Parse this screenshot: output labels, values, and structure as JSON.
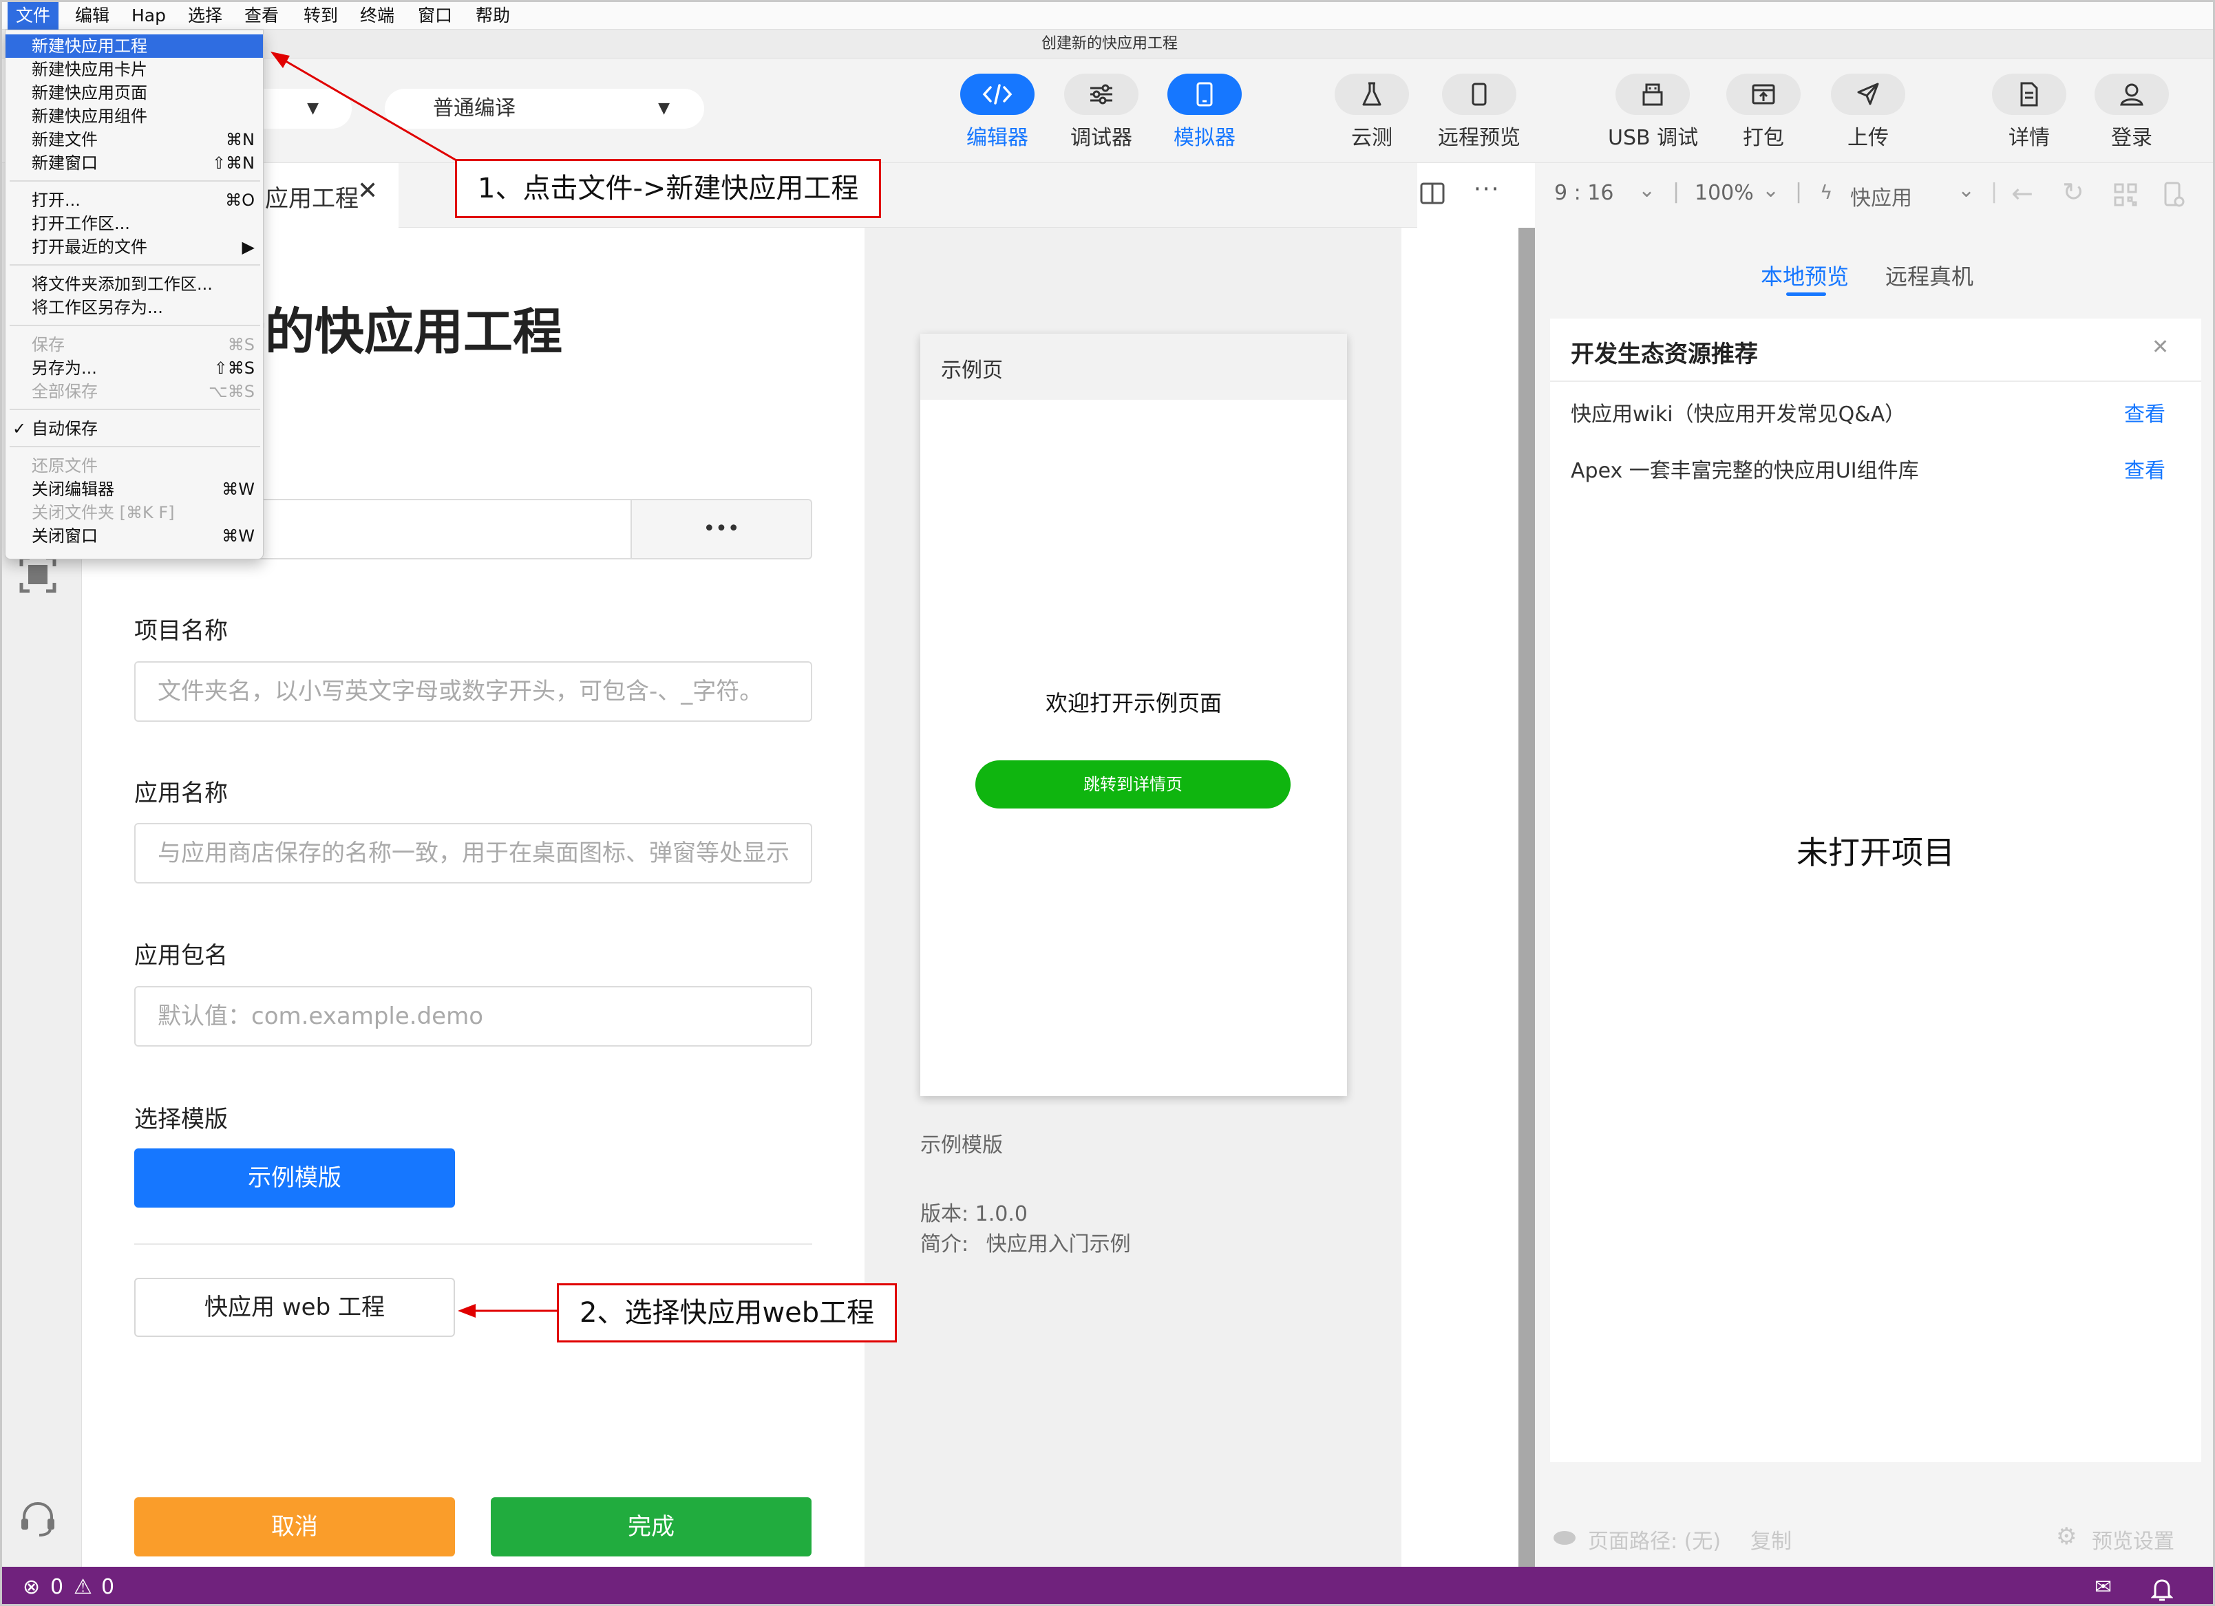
{
  "menubar": {
    "items": [
      "文件",
      "编辑",
      "Hap",
      "选择",
      "查看",
      "转到",
      "终端",
      "窗口",
      "帮助"
    ]
  },
  "titlebar": {
    "title": "创建新的快应用工程"
  },
  "toolbar": {
    "dropdown1": "",
    "dropdown2": "普通编译",
    "buttons": [
      "编辑器",
      "调试器",
      "模拟器",
      "云测",
      "远程预览",
      "USB 调试",
      "打包",
      "上传",
      "详情",
      "登录"
    ]
  },
  "file_menu": {
    "items": [
      {
        "label": "新建快应用工程",
        "shortcut": "",
        "state": "highlighted"
      },
      {
        "label": "新建快应用卡片",
        "shortcut": "",
        "state": "normal"
      },
      {
        "label": "新建快应用页面",
        "shortcut": "",
        "state": "normal"
      },
      {
        "label": "新建快应用组件",
        "shortcut": "",
        "state": "normal"
      },
      {
        "label": "新建文件",
        "shortcut": "⌘N",
        "state": "normal"
      },
      {
        "label": "新建窗口",
        "shortcut": "⇧⌘N",
        "state": "normal"
      },
      {
        "label": "打开...",
        "shortcut": "⌘O",
        "state": "normal"
      },
      {
        "label": "打开工作区...",
        "shortcut": "",
        "state": "normal"
      },
      {
        "label": "打开最近的文件",
        "shortcut": "▶",
        "state": "normal"
      },
      {
        "label": "将文件夹添加到工作区...",
        "shortcut": "",
        "state": "normal"
      },
      {
        "label": "将工作区另存为...",
        "shortcut": "",
        "state": "normal"
      },
      {
        "label": "保存",
        "shortcut": "⌘S",
        "state": "disabled"
      },
      {
        "label": "另存为...",
        "shortcut": "⇧⌘S",
        "state": "normal"
      },
      {
        "label": "全部保存",
        "shortcut": "⌥⌘S",
        "state": "disabled"
      },
      {
        "label": "自动保存",
        "shortcut": "",
        "state": "checked"
      },
      {
        "label": "还原文件",
        "shortcut": "",
        "state": "disabled"
      },
      {
        "label": "关闭编辑器",
        "shortcut": "⌘W",
        "state": "normal"
      },
      {
        "label": "关闭文件夹 [⌘K F]",
        "shortcut": "",
        "state": "disabled"
      },
      {
        "label": "关闭窗口",
        "shortcut": "⌘W",
        "state": "normal"
      }
    ]
  },
  "editor": {
    "tab_label": "应用工程",
    "heading": "新的快应用工程",
    "project_name_label": "项目名称",
    "project_name_placeholder": "文件夹名，以小写英文字母或数字开头，可包含-、_字符。",
    "app_name_label": "应用名称",
    "app_name_placeholder": "与应用商店保存的名称一致，用于在桌面图标、弹窗等处显示",
    "package_label": "应用包名",
    "package_placeholder": "默认值：com.example.demo",
    "template_label": "选择模版",
    "template_selected": "示例模版",
    "template_web": "快应用 web 工程",
    "path_more": "•••",
    "cancel": "取消",
    "done": "完成"
  },
  "preview": {
    "phone_title": "示例页",
    "welcome": "欢迎打开示例页面",
    "detail_button": "跳转到详情页",
    "template_name": "示例模版",
    "version_label": "版本:",
    "version": "1.0.0",
    "intro_label": "简介:",
    "intro": "快应用入门示例"
  },
  "simulator": {
    "ratio": "9 : 16",
    "zoom": "100%",
    "runtime": "快应用",
    "tabs": [
      "本地预览",
      "远程真机"
    ],
    "resource_title": "开发生态资源推荐",
    "resources": [
      {
        "text": "快应用wiki（快应用开发常见Q&A）",
        "action": "查看"
      },
      {
        "text": "Apex 一套丰富完整的快应用UI组件库",
        "action": "查看"
      }
    ],
    "empty": "未打开项目",
    "page_path": "页面路径: (无)",
    "copy": "复制",
    "preview_settings": "预览设置"
  },
  "annotations": {
    "step1": "1、点击文件->新建快应用工程",
    "step2": "2、选择快应用web工程"
  },
  "statusbar": {
    "errors": "0",
    "warnings": "0"
  },
  "colors": {
    "accent": "#1677ff",
    "green": "#21ac3e",
    "orange": "#fa9d2a",
    "status": "#70227d",
    "annotation": "#e00000"
  }
}
